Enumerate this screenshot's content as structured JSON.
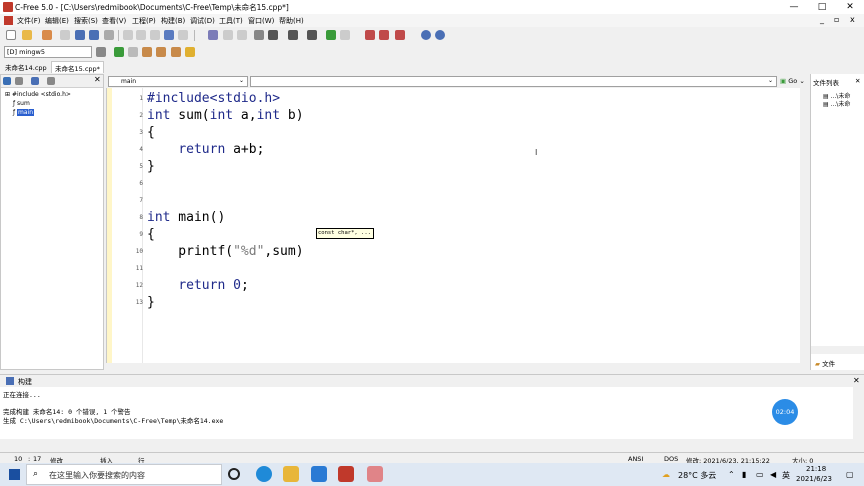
{
  "window": {
    "title": "C-Free 5.0 - [C:\\Users\\redmibook\\Documents\\C-Free\\Temp\\未命名15.cpp*]",
    "controls": {
      "min": "—",
      "max": "□",
      "close": "✕"
    }
  },
  "menu": [
    "文件(F)",
    "编辑(E)",
    "搜索(S)",
    "查看(V)",
    "工程(P)",
    "构建(B)",
    "调试(D)",
    "工具(T)",
    "窗口(W)",
    "帮助(H)"
  ],
  "compiler": "[D] mingw5",
  "file_tabs": [
    "未命名14.cpp",
    "未命名15.cpp*"
  ],
  "tree": {
    "items": [
      "#include <stdio.h>",
      "sum",
      "main"
    ]
  },
  "scope_label": "main",
  "go_label": "Go",
  "right_panel": {
    "title": "文件列表",
    "items": [
      "...\\未命",
      "...\\未命"
    ],
    "footer": "文件"
  },
  "lines": [
    {
      "n": "1",
      "code": "#include<stdio.h>"
    },
    {
      "n": "2",
      "code": "int sum(int a,int b)"
    },
    {
      "n": "3",
      "code": "{"
    },
    {
      "n": "4",
      "code": "    return a+b;"
    },
    {
      "n": "5",
      "code": "}"
    },
    {
      "n": "6",
      "code": ""
    },
    {
      "n": "7",
      "code": ""
    },
    {
      "n": "8",
      "code": "int main()"
    },
    {
      "n": "9",
      "code": "{"
    },
    {
      "n": "10",
      "code": "    printf(\"%d\",sum)"
    },
    {
      "n": "11",
      "code": ""
    },
    {
      "n": "12",
      "code": "    return 0;"
    },
    {
      "n": "13",
      "code": "}"
    }
  ],
  "tooltip": "const char*, ...",
  "build": {
    "title": "构建",
    "lines": [
      "正在连接...",
      "",
      "完成构建 未命名14: 0 个错误, 1 个警告",
      "生成 C:\\Users\\redmibook\\Documents\\C-Free\\Temp\\未命名14.exe"
    ],
    "timer": "02:04"
  },
  "status": {
    "line": "10",
    "sep": ":",
    "col": "17",
    "modified": "修改",
    "insert": "插入",
    "row": "行",
    "encoding": "ANSI",
    "os": "DOS",
    "modtime": "修改: 2021/6/23, 21:15:22",
    "size": "大小: 0"
  },
  "taskbar": {
    "search_placeholder": "在这里输入你要搜索的内容",
    "weather": "28°C 多云",
    "ime": "英",
    "time": "21:18",
    "date": "2021/6/23"
  },
  "colors": {
    "keyword": "#1f2a8a",
    "timer": "#2b8ce6"
  }
}
